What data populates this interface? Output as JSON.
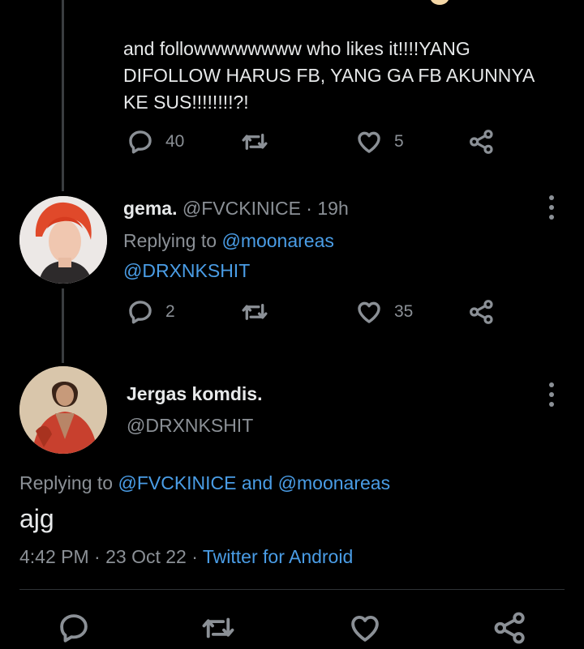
{
  "thread_top": {
    "text": "and followwwwwwww who likes it!!!!YANG DIFOLLOW HARUS FB, YANG GA FB AKUNNYA KE SUS!!!!!!!!?!",
    "replies": "40",
    "likes": "5"
  },
  "reply1": {
    "name": "gema.",
    "handle": "@FVCKINICE",
    "dot": "·",
    "time": "19h",
    "replying_to_label": "Replying to",
    "replying_to_1": "@moonareas",
    "replying_to_2": "@DRXNKSHIT",
    "replies": "2",
    "likes": "35"
  },
  "main": {
    "name": "Jergas komdis.",
    "handle": "@DRXNKSHIT",
    "replying_to_label": "Replying to",
    "replying_to_1": "@FVCKINICE",
    "replying_and": "and",
    "replying_to_2": "@moonareas",
    "text": "ajg",
    "time": "4:42 PM",
    "dot1": "·",
    "date": "23 Oct 22",
    "dot2": "·",
    "source": "Twitter for Android"
  },
  "icons": [
    "reply-icon",
    "retweet-icon",
    "like-icon",
    "share-icon",
    "more-icon"
  ],
  "colors": {
    "background": "#000000",
    "text": "#e7e9ea",
    "muted": "#8b9096",
    "link": "#4a9de6"
  }
}
